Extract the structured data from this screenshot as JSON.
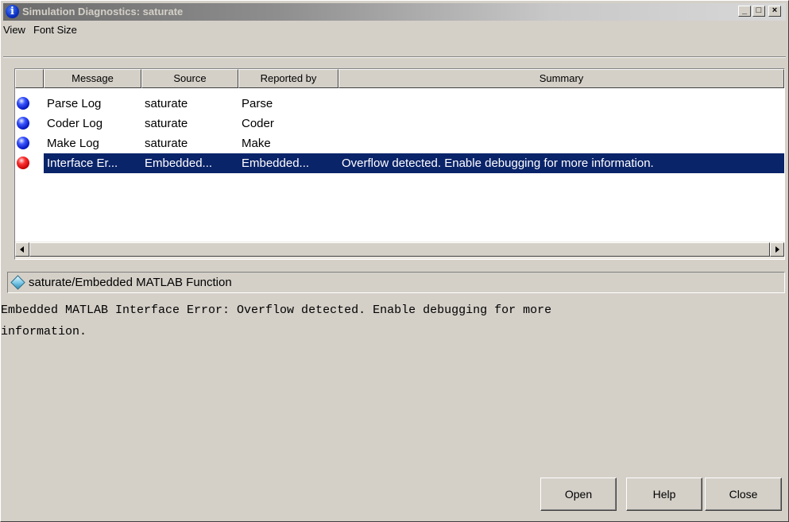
{
  "window": {
    "title": "Simulation Diagnostics: saturate",
    "controls": {
      "minimize": "_",
      "maximize": "□",
      "close": "×"
    }
  },
  "menu": [
    "View",
    "Font Size"
  ],
  "table": {
    "columns": [
      "",
      "Message",
      "Source",
      "Reported by",
      "Summary"
    ],
    "rows": [
      {
        "status": "blue",
        "message": "Parse Log",
        "source": "saturate",
        "reported_by": "Parse",
        "summary": ""
      },
      {
        "status": "blue",
        "message": "Coder Log",
        "source": "saturate",
        "reported_by": "Coder",
        "summary": ""
      },
      {
        "status": "blue",
        "message": "Make Log",
        "source": "saturate",
        "reported_by": "Make",
        "summary": ""
      },
      {
        "status": "red",
        "message": "Interface Er...",
        "source": "Embedded...",
        "reported_by": "Embedded...",
        "summary": "Overflow detected. Enable debugging for more information.",
        "selected": true
      }
    ]
  },
  "colors": {
    "selection": "#0a246a",
    "info_bullet": "#0010b8",
    "error_bullet": "#c00000"
  },
  "detail": {
    "path": "saturate/Embedded MATLAB Function",
    "message": "Embedded MATLAB Interface Error: Overflow detected. Enable debugging for more\ninformation."
  },
  "buttons": {
    "open": "Open",
    "help": "Help",
    "close": "Close"
  }
}
